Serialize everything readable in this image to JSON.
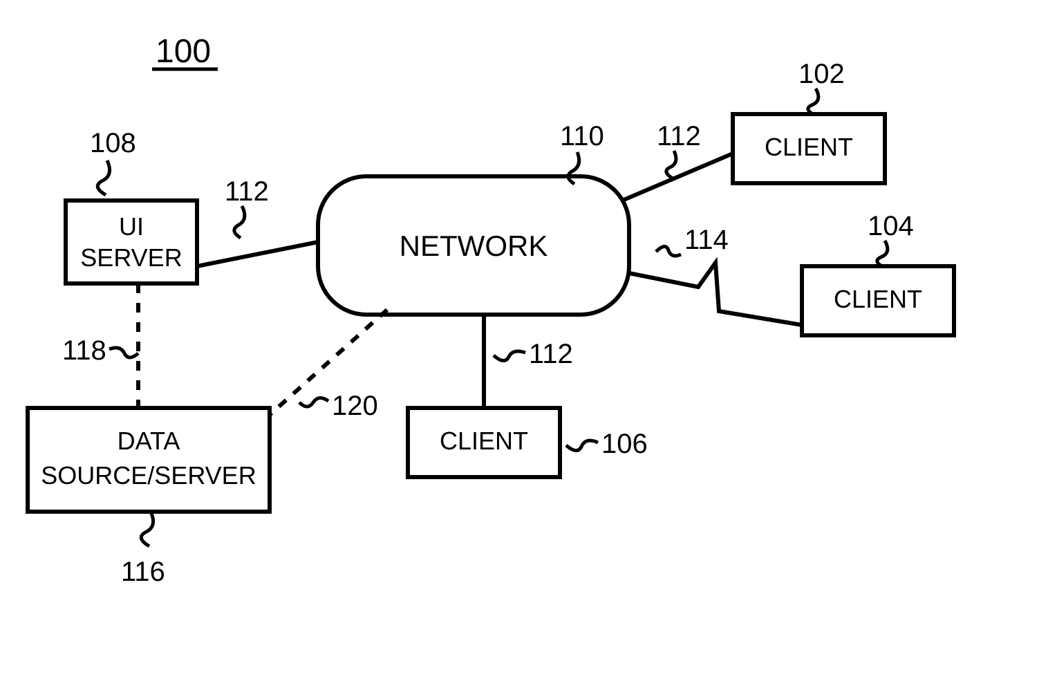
{
  "figure_number": "100",
  "network": {
    "label": "NETWORK",
    "ref": "110"
  },
  "ui_server": {
    "line1": "UI",
    "line2": "SERVER",
    "ref": "108"
  },
  "data_source": {
    "line1": "DATA",
    "line2": "SOURCE/SERVER",
    "ref": "116"
  },
  "client_top": {
    "label": "CLIENT",
    "ref": "102"
  },
  "client_right": {
    "label": "CLIENT",
    "ref": "104"
  },
  "client_bottom": {
    "label": "CLIENT",
    "ref": "106"
  },
  "link_ui_net": {
    "ref": "112"
  },
  "link_net_top": {
    "ref": "112"
  },
  "link_net_bottom": {
    "ref": "112"
  },
  "link_net_right": {
    "ref": "114"
  },
  "link_ui_ds": {
    "ref": "118"
  },
  "link_net_ds": {
    "ref": "120"
  }
}
